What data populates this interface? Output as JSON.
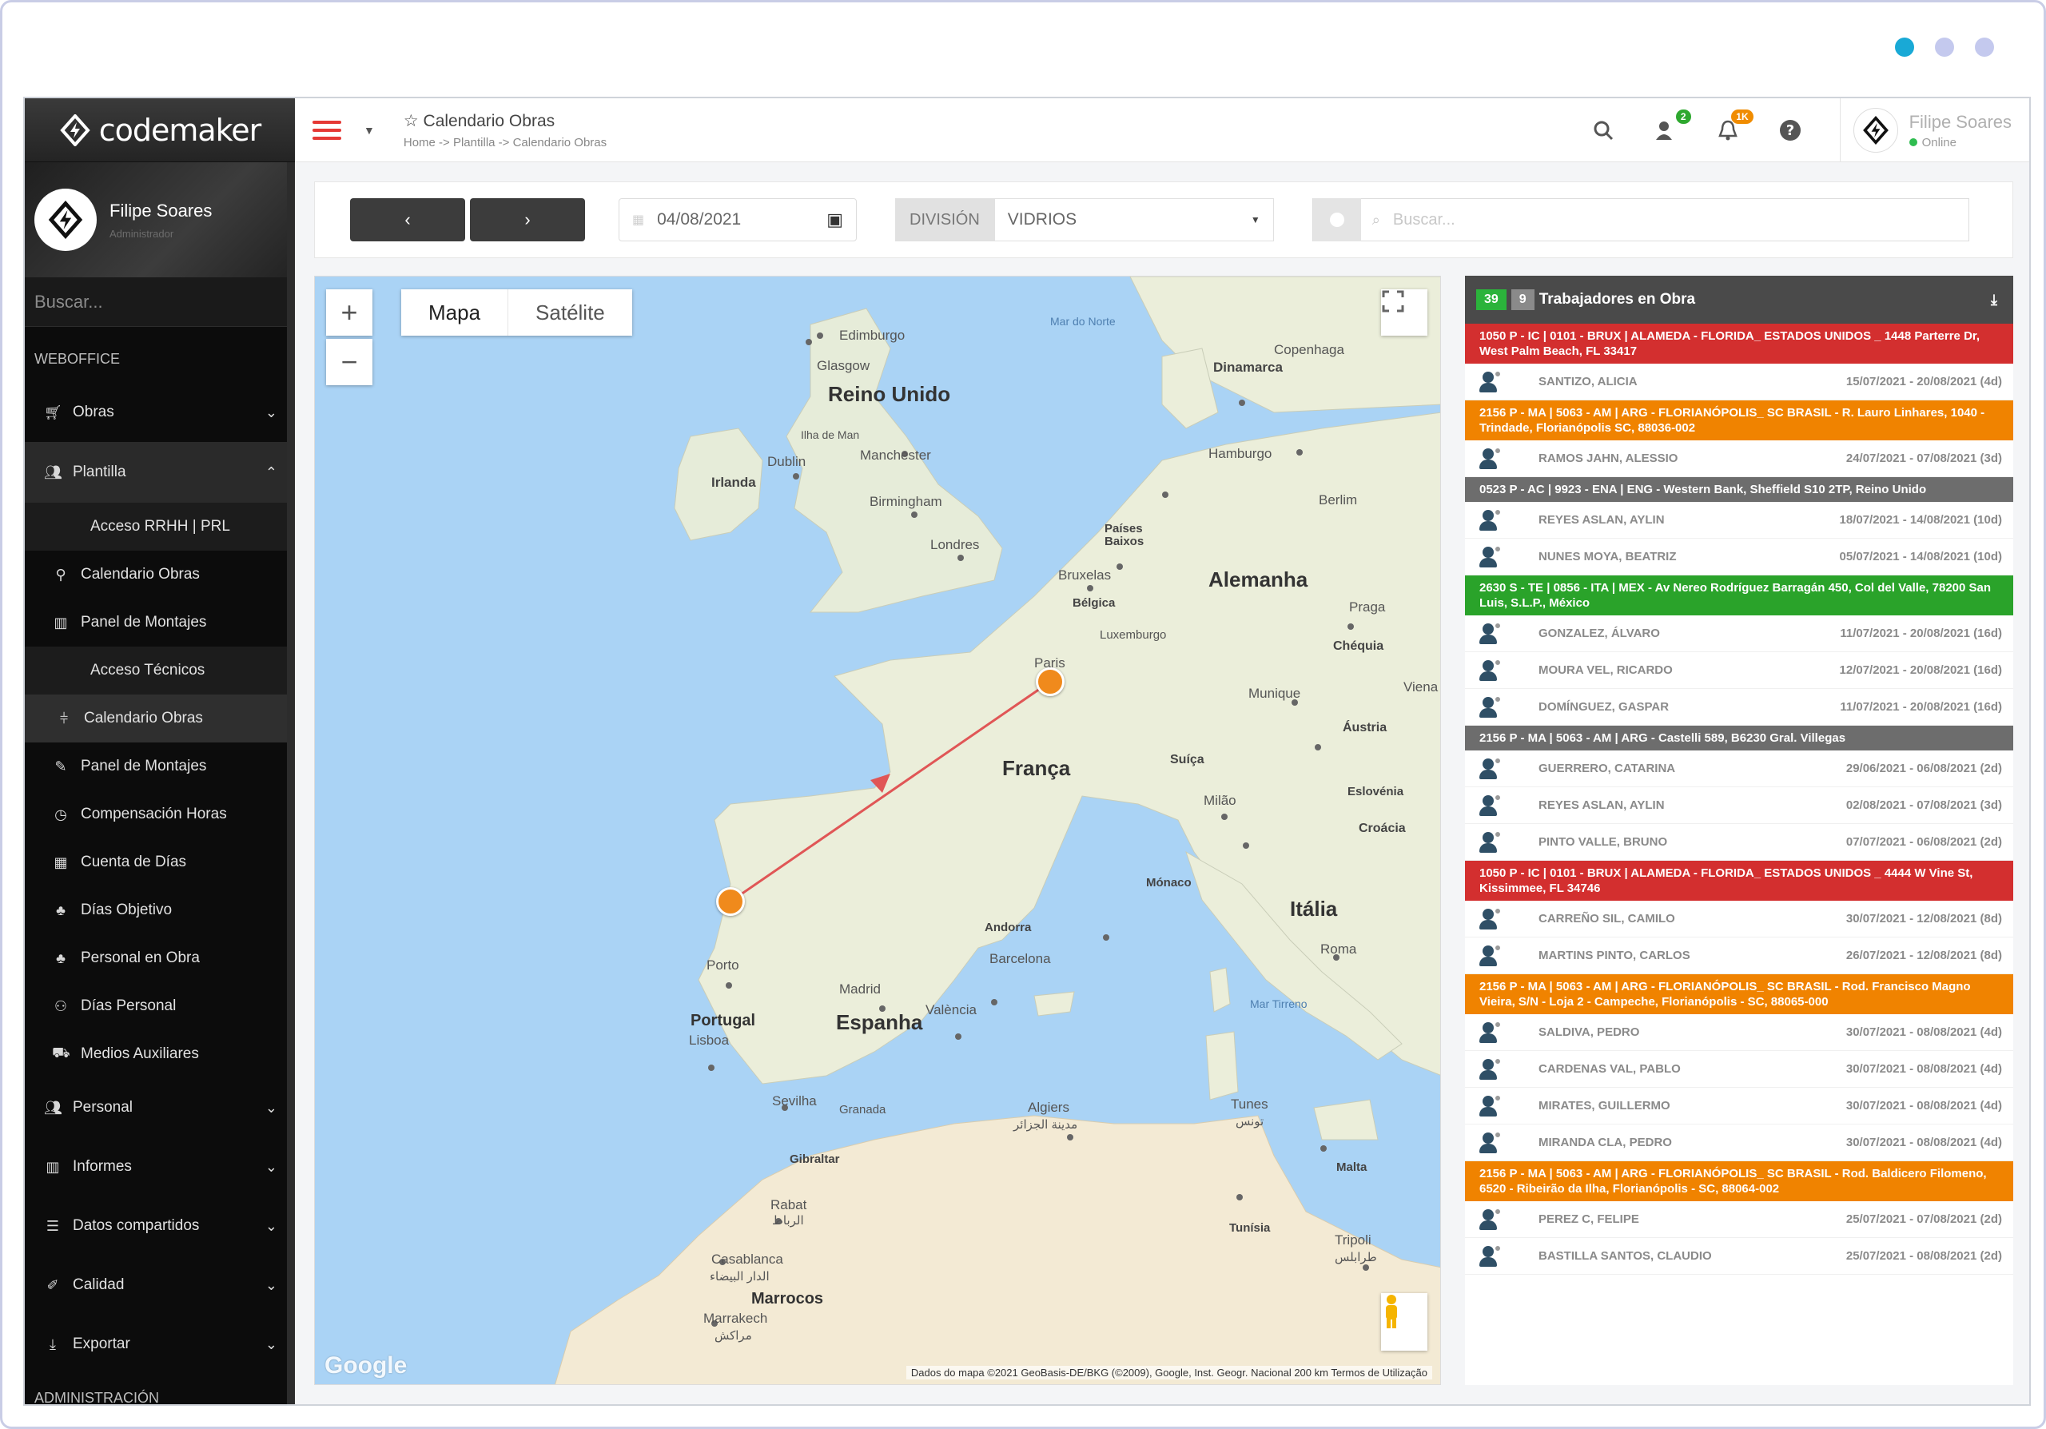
{
  "brand": {
    "name": "codemaker"
  },
  "user": {
    "name": "Filipe Soares",
    "role": "Administrador",
    "status": "Online"
  },
  "sidebar": {
    "search_placeholder": "Buscar...",
    "section_weboffice": "WEBOFFICE",
    "section_admin": "ADMINISTRACIÓN",
    "items": [
      {
        "label": "Obras"
      },
      {
        "label": "Plantilla"
      },
      {
        "label": "Acceso RRHH | PRL"
      },
      {
        "label": "Calendario Obras"
      },
      {
        "label": "Panel de Montajes"
      },
      {
        "label": "Acceso Técnicos"
      },
      {
        "label": "Calendario Obras"
      },
      {
        "label": "Panel de Montajes"
      },
      {
        "label": "Compensación Horas"
      },
      {
        "label": "Cuenta de Días"
      },
      {
        "label": "Días Objetivo"
      },
      {
        "label": "Personal en Obra"
      },
      {
        "label": "Días Personal"
      },
      {
        "label": "Medios Auxiliares"
      },
      {
        "label": "Personal"
      },
      {
        "label": "Informes"
      },
      {
        "label": "Datos compartidos"
      },
      {
        "label": "Calidad"
      },
      {
        "label": "Exportar"
      }
    ]
  },
  "header": {
    "title": "Calendario Obras",
    "breadcrumb": "Home -> Plantilla -> Calendario Obras",
    "badges": {
      "users": "2",
      "bell": "1K"
    }
  },
  "filters": {
    "prev": "‹",
    "next": "›",
    "date": "04/08/2021",
    "division_label": "DIVISIÓN",
    "division_value": "VIDRIOS",
    "search_placeholder": "Buscar..."
  },
  "map": {
    "type_map": "Mapa",
    "type_satellite": "Satélite",
    "zoom_in": "+",
    "zoom_out": "−",
    "google": "Google",
    "attribution": "Dados do mapa ©2021 GeoBasis-DE/BKG (©2009), Google, Inst. Geogr. Nacional   200 km   Termos de Utilização",
    "labels": {
      "mar_norte": "Mar do Norte",
      "edimburgo": "Edimburgo",
      "glasgow": "Glasgow",
      "reino_unido": "Reino Unido",
      "ilha_man": "Ilha de Man",
      "dublin": "Dublin",
      "irlanda": "Irlanda",
      "manchester": "Manchester",
      "birmingham": "Birmingham",
      "londres": "Londres",
      "dinamarca": "Dinamarca",
      "copenhaga": "Copenhaga",
      "hamburgo": "Hamburgo",
      "berlim": "Berlim",
      "paises_baixos": "Países Baixos",
      "bruxelas": "Bruxelas",
      "belgica": "Bélgica",
      "alemanha": "Alemanha",
      "praga": "Praga",
      "luxemburgo": "Luxemburgo",
      "chequia": "Chéquia",
      "paris": "Paris",
      "munique": "Munique",
      "viena": "Viena",
      "austria": "Áustria",
      "franca": "França",
      "suica": "Suíça",
      "milao": "Milão",
      "eslovenia": "Eslovénia",
      "croacia": "Croácia",
      "monaco": "Mónaco",
      "italia": "Itália",
      "andorra": "Andorra",
      "barcelona": "Barcelona",
      "roma": "Roma",
      "porto": "Porto",
      "madrid": "Madrid",
      "portugal": "Portugal",
      "lisboa": "Lisboa",
      "espanha": "Espanha",
      "valencia": "València",
      "mar_tirreno": "Mar Tirreno",
      "sevilha": "Sevilha",
      "granada": "Granada",
      "algiers": "Algiers",
      "algiers_ar": "مدينة الجزائر",
      "tunes": "Tunes",
      "tunes_ar": "تونس",
      "gibraltar": "Gibraltar",
      "malta": "Malta",
      "rabat": "Rabat",
      "rabat_ar": "الرباط",
      "tunisia": "Tunísia",
      "tripoli": "Tripoli",
      "tripoli_ar": "طرابلس",
      "casablanca": "Casablanca",
      "casablanca_ar": "الدار البيضاء",
      "marrocos": "Marrocos",
      "marrakech": "Marrakech",
      "marrakech_ar": "مراكش"
    }
  },
  "panel": {
    "count_total": "39",
    "count_obras": "9",
    "title": "Trabajadores en Obra",
    "groups": [
      {
        "color": "red",
        "title": "1050 P - IC | 0101 - BRUX | ALAMEDA - FLORIDA_ ESTADOS UNIDOS _ 1448 Parterre Dr, West Palm Beach, FL 33417",
        "workers": [
          {
            "name": "SANTIZO, ALICIA",
            "dates": "15/07/2021 - 20/08/2021 (4d)"
          }
        ]
      },
      {
        "color": "orange",
        "title": "2156 P - MA | 5063 - AM | ARG - FLORIANÓPOLIS_ SC BRASIL - R. Lauro Linhares, 1040 - Trindade, Florianópolis SC, 88036-002",
        "workers": [
          {
            "name": "RAMOS JAHN, ALESSIO",
            "dates": "24/07/2021 - 07/08/2021 (3d)"
          }
        ]
      },
      {
        "color": "gray",
        "title": "0523 P - AC | 9923 - ENA | ENG - Western Bank, Sheffield S10 2TP, Reino Unido",
        "workers": [
          {
            "name": "REYES ASLAN, AYLIN",
            "dates": "18/07/2021 - 14/08/2021 (10d)"
          },
          {
            "name": "NUNES MOYA, BEATRIZ",
            "dates": "05/07/2021 - 14/08/2021 (10d)"
          }
        ]
      },
      {
        "color": "green",
        "title": "2630 S - TE | 0856 - ITA | MEX - Av Nereo Rodríguez Barragán 450, Col del Valle, 78200 San Luis, S.L.P., México",
        "workers": [
          {
            "name": "GONZALEZ, ÁLVARO",
            "dates": "11/07/2021 - 20/08/2021 (16d)"
          },
          {
            "name": "MOURA VEL, RICARDO",
            "dates": "12/07/2021 - 20/08/2021 (16d)"
          },
          {
            "name": "DOMÍNGUEZ, GASPAR",
            "dates": "11/07/2021 - 20/08/2021 (16d)"
          }
        ]
      },
      {
        "color": "gray",
        "title": "2156 P - MA | 5063 - AM | ARG - Castelli 589, B6230 Gral. Villegas",
        "workers": [
          {
            "name": "GUERRERO, CATARINA",
            "dates": "29/06/2021 - 06/08/2021 (2d)"
          },
          {
            "name": "REYES ASLAN, AYLIN",
            "dates": "02/08/2021 - 07/08/2021 (3d)"
          },
          {
            "name": "PINTO VALLE, BRUNO",
            "dates": "07/07/2021 - 06/08/2021 (2d)"
          }
        ]
      },
      {
        "color": "red",
        "title": "1050 P - IC | 0101 - BRUX | ALAMEDA - FLORIDA_ ESTADOS UNIDOS _ 4444 W Vine St, Kissimmee, FL 34746",
        "workers": [
          {
            "name": "CARREÑO SIL, CAMILO",
            "dates": "30/07/2021 - 12/08/2021 (8d)"
          },
          {
            "name": "MARTINS PINTO, CARLOS",
            "dates": "26/07/2021 - 12/08/2021 (8d)"
          }
        ]
      },
      {
        "color": "orange",
        "title": "2156 P - MA | 5063 - AM | ARG - FLORIANÓPOLIS_ SC BRASIL - Rod. Francisco Magno Vieira, S/N - Loja 2 - Campeche, Florianópolis - SC, 88065-000",
        "workers": [
          {
            "name": "SALDIVA, PEDRO",
            "dates": "30/07/2021 - 08/08/2021 (4d)"
          },
          {
            "name": "CARDENAS VAL, PABLO",
            "dates": "30/07/2021 - 08/08/2021 (4d)"
          },
          {
            "name": "MIRATES, GUILLERMO",
            "dates": "30/07/2021 - 08/08/2021 (4d)"
          },
          {
            "name": "MIRANDA CLA, PEDRO",
            "dates": "30/07/2021 - 08/08/2021 (4d)"
          }
        ]
      },
      {
        "color": "orange",
        "title": "2156 P - MA | 5063 - AM | ARG - FLORIANÓPOLIS_ SC BRASIL - Rod. Baldicero Filomeno, 6520 - Ribeirão da Ilha, Florianópolis - SC, 88064-002",
        "workers": [
          {
            "name": "PEREZ C, FELIPE",
            "dates": "25/07/2021 - 07/08/2021 (2d)"
          },
          {
            "name": "BASTILLA SANTOS, CLAUDIO",
            "dates": "25/07/2021 - 08/08/2021 (2d)"
          }
        ]
      }
    ]
  },
  "colors": {
    "accent": "#e53935",
    "group_red": "#d32f2f",
    "group_orange": "#f08300",
    "group_gray": "#6d6d6d",
    "group_green": "#2aa32a"
  }
}
